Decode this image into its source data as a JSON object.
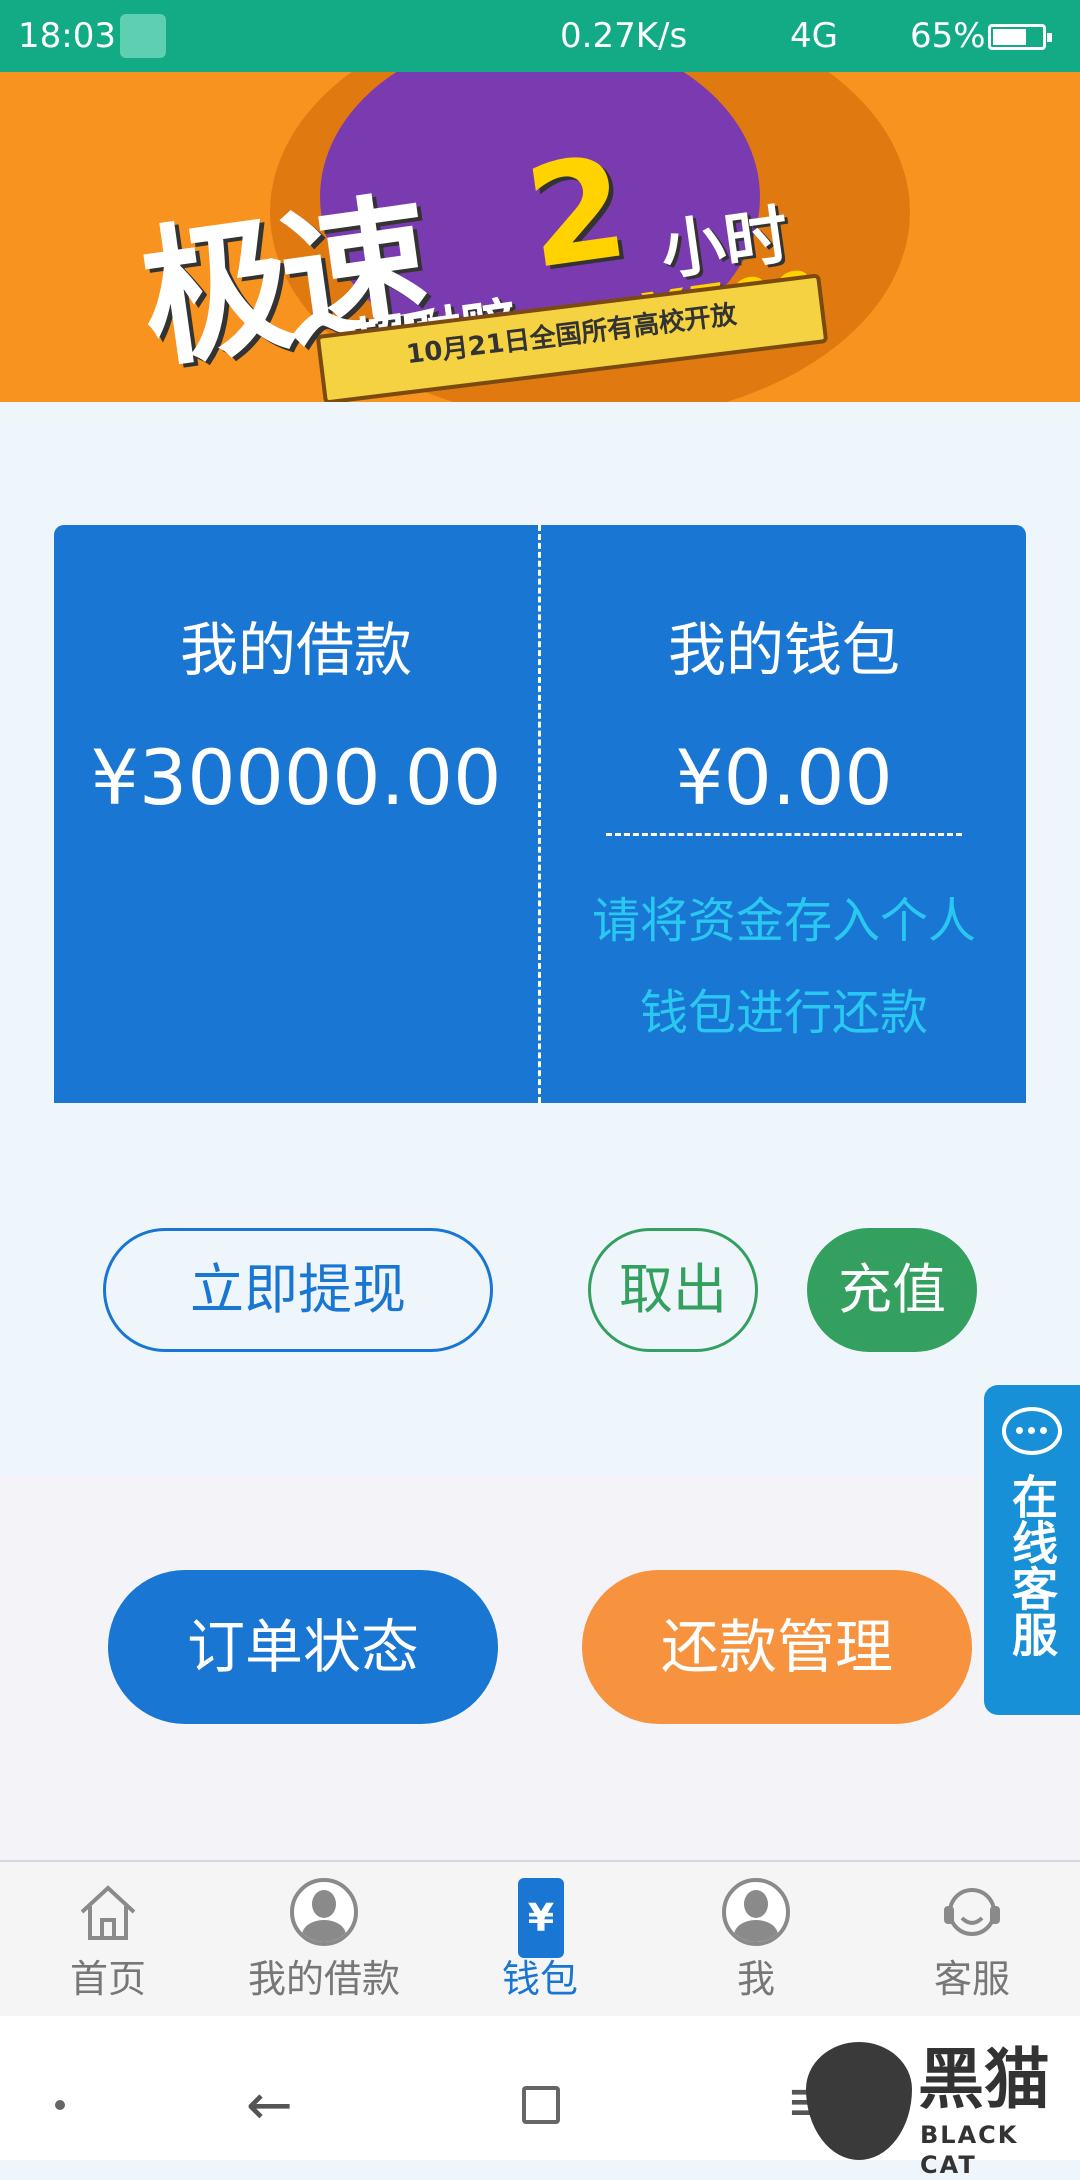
{
  "status_bar": {
    "time": "18:03",
    "net_speed": "0.27K/s",
    "network": "4G",
    "battery_pct": "65%",
    "battery_level": 0.65
  },
  "banner": {
    "headline": "极速",
    "hours_number": "2",
    "hours_label": "小时",
    "subline": "超时赔",
    "compensation": "¥500",
    "ribbon": "10月21日全国所有高校开放"
  },
  "card": {
    "loan_title": "我的借款",
    "loan_amount": "¥30000.00",
    "wallet_title": "我的钱包",
    "wallet_amount": "¥0.00",
    "wallet_note": "请将资金存入个人钱包进行还款"
  },
  "actions": {
    "withdraw_now": "立即提现",
    "take_out": "取出",
    "recharge": "充值",
    "order_status": "订单状态",
    "repay_manage": "还款管理"
  },
  "float_service": {
    "label": "在线客服",
    "icon": "chat-bubble-icon"
  },
  "tabs": [
    {
      "label": "首页",
      "icon": "home-icon",
      "active": false
    },
    {
      "label": "我的借款",
      "icon": "user-avatar-icon",
      "active": false
    },
    {
      "label": "钱包",
      "icon": "wallet-phone-icon",
      "glyph": "¥",
      "active": true
    },
    {
      "label": "我",
      "icon": "user-avatar-icon",
      "active": false
    },
    {
      "label": "客服",
      "icon": "headset-icon",
      "active": false
    }
  ],
  "colors": {
    "status_bar": "#12ab86",
    "primary_blue": "#1a76d3",
    "green": "#34a060",
    "orange": "#f7923e",
    "note_cyan": "#29c8f0"
  },
  "watermark": {
    "cn": "黑猫",
    "en": "BLACK CAT"
  }
}
